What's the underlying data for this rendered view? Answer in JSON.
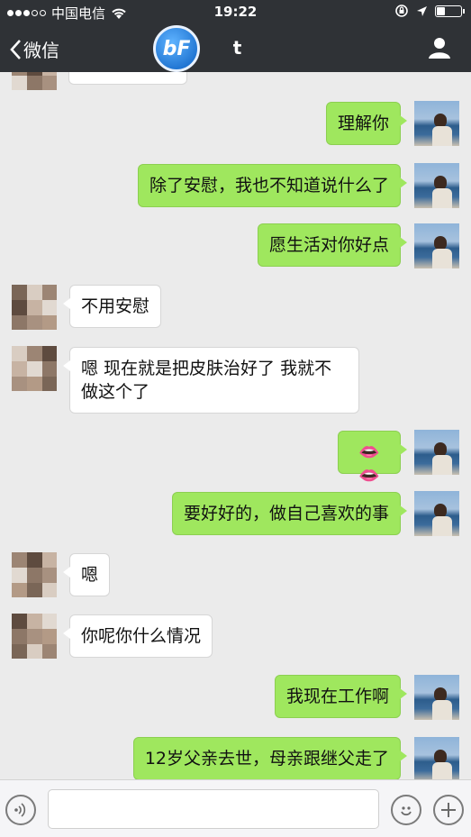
{
  "status_bar": {
    "carrier": "中国电信",
    "time": "19:22"
  },
  "nav": {
    "back_label": "微信",
    "logo_text": "bF",
    "chat_title": "t"
  },
  "messages": [
    {
      "side": "other",
      "text": ""
    },
    {
      "side": "me",
      "text": "理解你"
    },
    {
      "side": "me",
      "text": "除了安慰，我也不知道说什么了"
    },
    {
      "side": "me",
      "text": "愿生活对你好点"
    },
    {
      "side": "other",
      "text": "不用安慰"
    },
    {
      "side": "other",
      "text": "嗯 现在就是把皮肤治好了 我就不做这个了"
    },
    {
      "side": "me",
      "text": "👄👄"
    },
    {
      "side": "me",
      "text": "要好好的，做自己喜欢的事"
    },
    {
      "side": "other",
      "text": "嗯"
    },
    {
      "side": "other",
      "text": "你呢你什么情况"
    },
    {
      "side": "me",
      "text": "我现在工作啊"
    },
    {
      "side": "me",
      "text": "12岁父亲去世，母亲跟继父走了"
    }
  ],
  "colors": {
    "nav_bg": "#2f3236",
    "chat_bg": "#ebebeb",
    "my_bubble": "#9fe75e"
  }
}
